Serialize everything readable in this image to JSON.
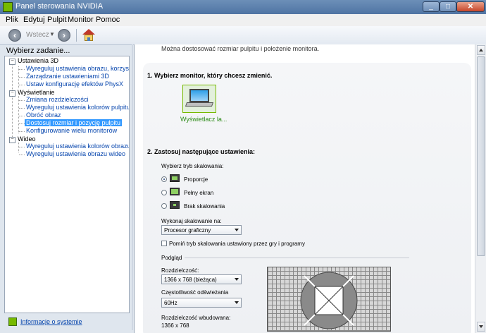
{
  "window": {
    "title": "Panel sterowania NVIDIA"
  },
  "menu": {
    "items": [
      "Plik",
      "Edytuj",
      "Pulpit",
      "Monitor",
      "Pomoc"
    ]
  },
  "toolbar": {
    "back_label": "Wstecz"
  },
  "sidebar": {
    "header": "Wybierz zadanie...",
    "categories": [
      {
        "label": "Ustawienia 3D",
        "items": [
          "Wyreguluj ustawienia obrazu, korzystając z",
          "Zarządzanie ustawieniami 3D",
          "Ustaw konfigurację efektów PhysX"
        ]
      },
      {
        "label": "Wyświetlanie",
        "items": [
          "Zmiana rozdzielczości",
          "Wyreguluj ustawienia kolorów pulpitu",
          "Obróć obraz",
          "Dostosuj rozmiar i pozycję pulpitu",
          "Konfigurowanie wielu monitorów"
        ]
      },
      {
        "label": "Wideo",
        "items": [
          "Wyreguluj ustawienia kolorów obrazu wideo",
          "Wyreguluj ustawienia obrazu wideo"
        ]
      }
    ],
    "selected": "Dostosuj rozmiar i pozycję pulpitu",
    "system_info": "Informacje o systemie"
  },
  "content": {
    "description": "Można dostosować rozmiar pulpitu i położenie monitora.",
    "section1": "1. Wybierz monitor, który chcesz zmienić.",
    "monitor_label": "Wyświetlacz la...",
    "section2": "2. Zastosuj następujące ustawienia:",
    "scaling_mode_label": "Wybierz tryb skalowania:",
    "scaling_options": [
      "Proporcje",
      "Pełny ekran",
      "Brak skalowania"
    ],
    "selected_scaling": "Proporcje",
    "perform_scaling_label": "Wykonaj skalowanie na:",
    "perform_scaling_value": "Procesor graficzny",
    "override_checkbox_label": "Pomiń tryb skalowania ustawiony przez gry i programy",
    "override_checked": false,
    "preview_label": "Podgląd",
    "resolution_label": "Rozdzielczość:",
    "resolution_value": "1366 x 768 (bieżąca)",
    "refresh_label": "Częstotliwość odświeżania",
    "refresh_value": "60Hz",
    "native_label": "Rozdzielczość wbudowana:",
    "native_value": "1366 x 768"
  },
  "colors": {
    "nvidia_green": "#76b900",
    "selection": "#3399ff",
    "link": "#0645ad"
  }
}
